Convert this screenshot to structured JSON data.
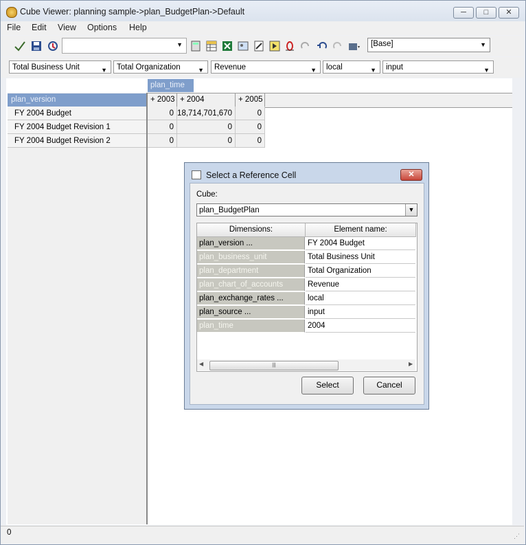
{
  "window": {
    "title": "Cube Viewer: planning sample->plan_BudgetPlan->Default",
    "minimize": "─",
    "maximize": "□",
    "close": "✕"
  },
  "menu": [
    "File",
    "Edit",
    "View",
    "Options",
    "Help"
  ],
  "toolbar": {
    "view_combo_value": "",
    "base_combo_value": "[Base]"
  },
  "filters": [
    {
      "value": "Total Business Unit"
    },
    {
      "value": "Total Organization"
    },
    {
      "value": "Revenue"
    },
    {
      "value": "local"
    },
    {
      "value": "input"
    }
  ],
  "grid": {
    "column_dimension": "plan_time",
    "row_dimension": "plan_version",
    "columns": [
      "+ 2003",
      "+ 2004",
      "+ 2005"
    ],
    "rows": [
      {
        "label": "FY 2004 Budget",
        "values": [
          "0",
          "18,714,701,670",
          "0"
        ]
      },
      {
        "label": "FY 2004 Budget Revision 1",
        "values": [
          "0",
          "0",
          "0"
        ]
      },
      {
        "label": "FY 2004 Budget Revision 2",
        "values": [
          "0",
          "0",
          "0"
        ]
      }
    ]
  },
  "status": {
    "text": "0"
  },
  "dialog": {
    "title": "Select a Reference Cell",
    "close": "✕",
    "cube_label": "Cube:",
    "cube_value": "plan_BudgetPlan",
    "col_dimensions": "Dimensions:",
    "col_element": "Element name:",
    "rows": [
      {
        "dimension": "plan_version ...",
        "element": "FY 2004 Budget",
        "active": true
      },
      {
        "dimension": "plan_business_unit",
        "element": "Total Business Unit",
        "active": false
      },
      {
        "dimension": "plan_department",
        "element": "Total Organization",
        "active": false
      },
      {
        "dimension": "plan_chart_of_accounts",
        "element": "Revenue",
        "active": false
      },
      {
        "dimension": "plan_exchange_rates ...",
        "element": "local",
        "active": true
      },
      {
        "dimension": "plan_source ...",
        "element": "input",
        "active": true
      },
      {
        "dimension": "plan_time",
        "element": "2004",
        "active": false
      }
    ],
    "select_label": "Select",
    "cancel_label": "Cancel"
  }
}
